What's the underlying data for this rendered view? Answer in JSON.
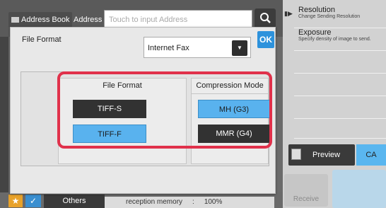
{
  "header": {
    "address_book_label": "Address Book",
    "address_label": "Address",
    "address_placeholder": "Touch to input Address"
  },
  "right_panel": {
    "items": [
      {
        "title": "Resolution",
        "subtitle": "Change Sending Resolution"
      },
      {
        "title": "Exposure",
        "subtitle": "Specify density of image to send."
      }
    ],
    "preview_label": "Preview",
    "ca_label": "CA",
    "receive_label": "Receive"
  },
  "bottom": {
    "others_label": "Others",
    "memory_label": "reception memory",
    "memory_sep": ":",
    "memory_value": "100%"
  },
  "dialog": {
    "title": "File Format",
    "format_select_value": "Internet Fax",
    "ok_label": "OK",
    "file_format": {
      "heading": "File Format",
      "options": [
        "TIFF-S",
        "TIFF-F"
      ],
      "selected": "TIFF-F"
    },
    "compression": {
      "heading": "Compression Mode",
      "options": [
        "MH (G3)",
        "MMR (G4)"
      ],
      "selected": "MH (G3)"
    }
  },
  "colors": {
    "selected": "#59b2ee",
    "unselected": "#323232",
    "highlight": "#e0314b",
    "ok": "#2d92dc"
  }
}
